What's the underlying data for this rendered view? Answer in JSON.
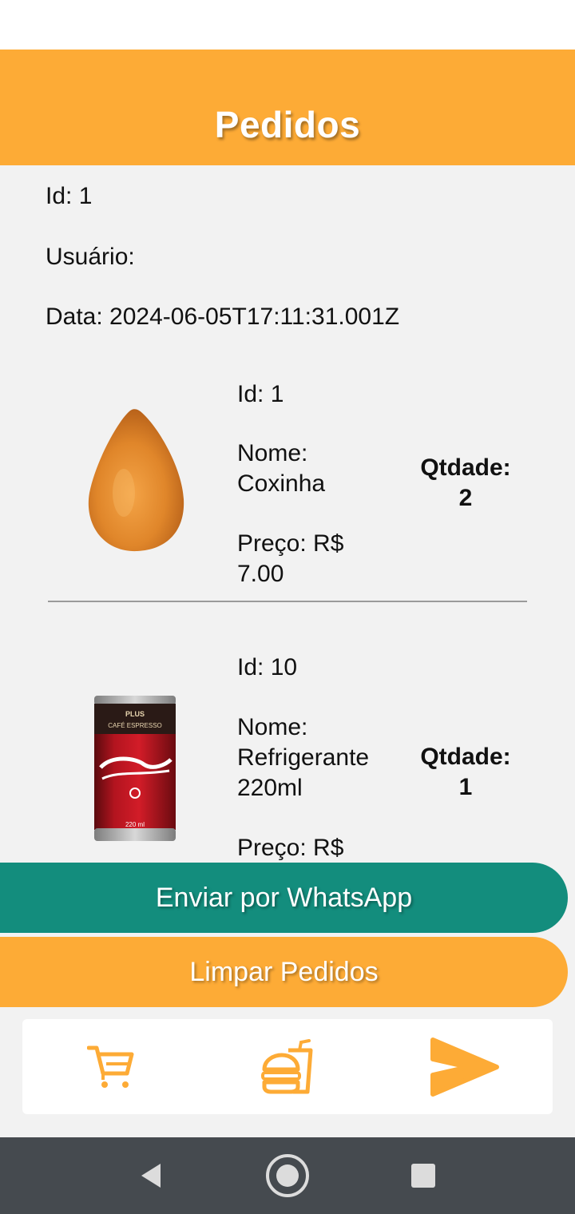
{
  "header": {
    "title": "Pedidos"
  },
  "order": {
    "id_text": "Id: 1",
    "user_text": "Usuário:",
    "date_text": "Data: 2024-06-05T17:11:31.001Z"
  },
  "items": [
    {
      "image_icon": "coxinha-image",
      "id_text": "Id: 1",
      "name_label": "Nome:",
      "name_value": "Coxinha",
      "price_label": "Preço: R$",
      "price_value": "7.00",
      "qty_label": "Qtdade:",
      "qty_value": "2"
    },
    {
      "image_icon": "soda-can-image",
      "id_text": "Id: 10",
      "name_label": "Nome:",
      "name_value_line1": "Refrigerante",
      "name_value_line2": "220ml",
      "price_label": "Preço: R$",
      "qty_label": "Qtdade:",
      "qty_value": "1"
    }
  ],
  "buttons": {
    "whatsapp_label": "Enviar por WhatsApp",
    "clear_label": "Limpar Pedidos"
  },
  "tabbar": {
    "items": [
      {
        "icon": "cart-icon"
      },
      {
        "icon": "burger-drink-icon"
      },
      {
        "icon": "send-icon"
      }
    ]
  },
  "colors": {
    "accent_orange": "#fdab36",
    "whatsapp_green": "#138d7d",
    "nav_bar": "#454a4f",
    "background": "#f2f2f2"
  },
  "system_nav": {
    "icons": [
      "back-icon",
      "home-icon",
      "recents-icon"
    ]
  }
}
